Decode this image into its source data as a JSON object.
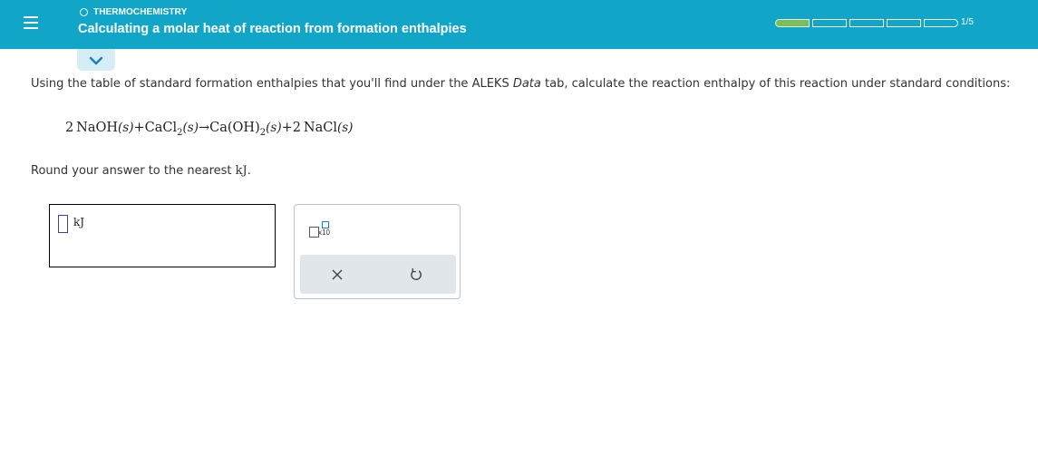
{
  "header": {
    "topic": "THERMOCHEMISTRY",
    "title": "Calculating a molar heat of reaction from formation enthalpies",
    "progress_text": "1/5",
    "progress_fraction": 0.2,
    "colors": {
      "header_bg": "#11a6c8",
      "progress_fill": "#7bbd5a"
    }
  },
  "icons": {
    "menu": "hamburger-icon",
    "collapse": "chevron-down-icon",
    "clear": "close-icon",
    "undo": "undo-icon",
    "sci": "scientific-notation-icon"
  },
  "question": {
    "prompt_before": "Using the table of standard formation enthalpies that you'll find under the ALEKS ",
    "prompt_italic": "Data",
    "prompt_after": " tab, calculate the reaction enthalpy of this reaction under standard conditions:",
    "equation": {
      "coef1": "2",
      "r1": "NaOH",
      "state_s": "(s)",
      "plus": "+",
      "r2": "CaCl",
      "sub2": "2",
      "arrow": "→",
      "p1": "Ca",
      "paren_open": "(",
      "oh": "OH",
      "paren_close": ")",
      "coef2": "2",
      "p2": "NaCl"
    },
    "round_before": "Round your answer to the nearest ",
    "round_unit": "kJ",
    "round_after": "."
  },
  "answer": {
    "value": "",
    "unit": "kJ"
  },
  "tools": {
    "sci_label": "x10"
  }
}
